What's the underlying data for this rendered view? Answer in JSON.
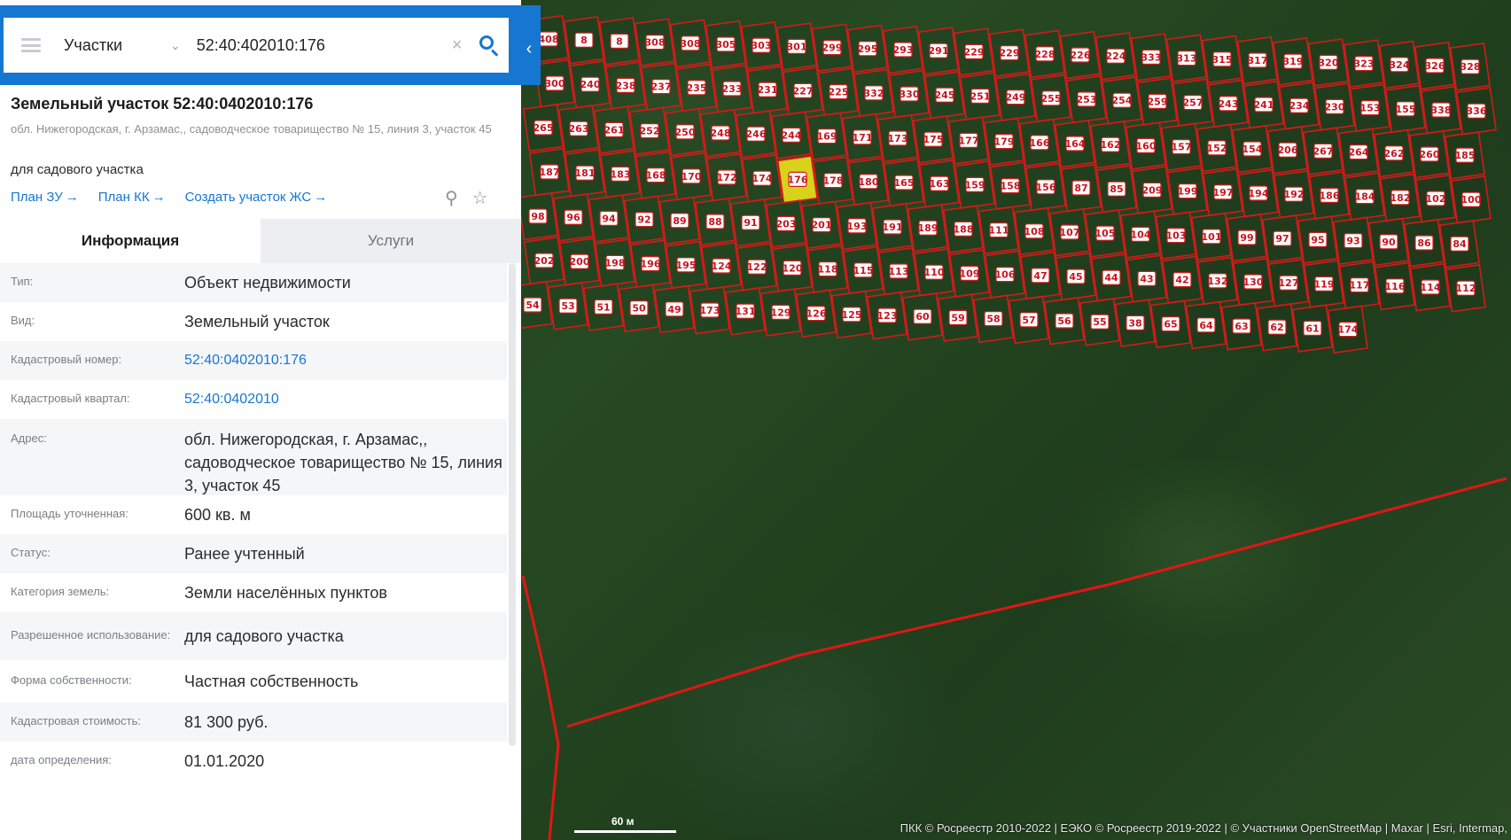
{
  "search": {
    "type": "Участки",
    "value": "52:40:402010:176"
  },
  "parcel": {
    "title": "Земельный участок 52:40:0402010:176",
    "address_short": "обл. Нижегородская, г. Арзамас,, садоводческое товарищество № 15, линия 3, участок 45",
    "purpose": "для садового участка",
    "links": [
      "План ЗУ",
      "План КК",
      "Создать участок ЖС"
    ]
  },
  "tabs": {
    "info": "Информация",
    "services": "Услуги"
  },
  "info_rows": [
    {
      "key": "Тип:",
      "value": "Объект недвижимости"
    },
    {
      "key": "Вид:",
      "value": "Земельный участок"
    },
    {
      "key": "Кадастровый номер:",
      "value": "52:40:0402010:176",
      "link": true
    },
    {
      "key": "Кадастровый квартал:",
      "value": "52:40:0402010",
      "link": true
    },
    {
      "key": "Адрес:",
      "value": "обл. Нижегородская, г. Арзамас,, садоводческое товарищество № 15, линия 3, участок 45"
    },
    {
      "key": "Площадь уточненная:",
      "value": "600 кв. м"
    },
    {
      "key": "Статус:",
      "value": "Ранее учтенный"
    },
    {
      "key": "Категория земель:",
      "value": "Земли населённых пунктов"
    },
    {
      "key": "Разрешенное использование:",
      "value": "для садового участка"
    },
    {
      "key": "Форма собственности:",
      "value": "Частная собственность"
    },
    {
      "key": "Кадастровая стоимость:",
      "value": "81 300 руб."
    },
    {
      "key": "дата определения:",
      "value": "01.01.2020"
    }
  ],
  "map": {
    "attribution": "ПКК © Росреестр 2010-2022 | ЕЭКО © Росреестр 2019-2022 | © Участники OpenStreetMap | Maxar | Esri, Intermap,",
    "scale": "60 м",
    "highlight_color": "#d8d21a",
    "boundary_color": "#d21a1a",
    "plots": [
      "408",
      "8",
      "8",
      "308",
      "308",
      "305",
      "303",
      "301",
      "299",
      "295",
      "293",
      "291",
      "229",
      "229",
      "228",
      "226",
      "224",
      "333",
      "313",
      "315",
      "317",
      "319",
      "320",
      "323",
      "324",
      "326",
      "328",
      "300",
      "240",
      "238",
      "237",
      "235",
      "233",
      "231",
      "227",
      "225",
      "332",
      "330",
      "245",
      "251",
      "249",
      "255",
      "253",
      "254",
      "259",
      "257",
      "243",
      "241",
      "234",
      "230",
      "153",
      "155",
      "338",
      "336",
      "265",
      "263",
      "261",
      "252",
      "250",
      "248",
      "246",
      "244",
      "169",
      "171",
      "173",
      "175",
      "177",
      "179",
      "166",
      "164",
      "162",
      "160",
      "157",
      "152",
      "154",
      "206",
      "267",
      "264",
      "262",
      "260",
      "185",
      "187",
      "181",
      "183",
      "168",
      "170",
      "172",
      "174",
      "176",
      "178",
      "180",
      "165",
      "163",
      "159",
      "158",
      "156",
      "87",
      "85",
      "209",
      "199",
      "197",
      "194",
      "192",
      "186",
      "184",
      "182",
      "102",
      "100",
      "98",
      "96",
      "94",
      "92",
      "89",
      "88",
      "91",
      "203",
      "201",
      "193",
      "191",
      "189",
      "188",
      "111",
      "108",
      "107",
      "105",
      "104",
      "103",
      "101",
      "99",
      "97",
      "95",
      "93",
      "90",
      "86",
      "84",
      "202",
      "200",
      "198",
      "196",
      "195",
      "124",
      "122",
      "120",
      "118",
      "115",
      "113",
      "110",
      "109",
      "106",
      "47",
      "45",
      "44",
      "43",
      "42",
      "132",
      "130",
      "127",
      "119",
      "117",
      "116",
      "114",
      "112",
      "54",
      "53",
      "51",
      "50",
      "49",
      "173",
      "131",
      "129",
      "126",
      "125",
      "123",
      "60",
      "59",
      "58",
      "57",
      "56",
      "55",
      "38",
      "65",
      "64",
      "63",
      "62",
      "61",
      "174"
    ]
  }
}
